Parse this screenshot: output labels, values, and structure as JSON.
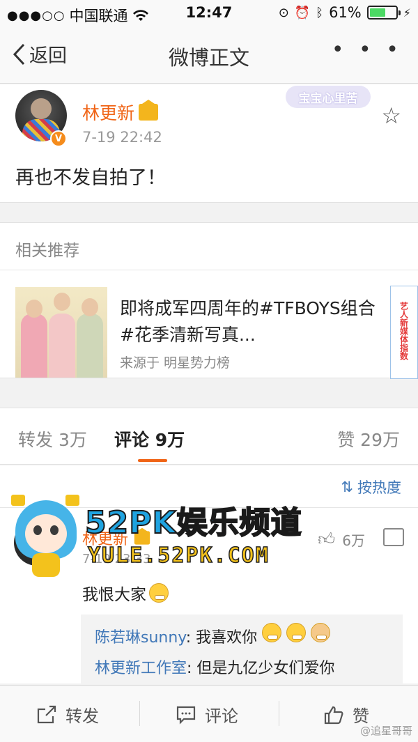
{
  "status_bar": {
    "carrier": "中国联通",
    "time": "12:47",
    "battery": "61%"
  },
  "navbar": {
    "back_label": "返回",
    "title": "微博正文",
    "more": "• • •"
  },
  "post": {
    "author": "林更新",
    "time": "7-19 22:42",
    "text": "再也不发自拍了！",
    "sticker_text": "宝宝心里苦",
    "verified": "V"
  },
  "recommend": {
    "heading": "相关推荐",
    "title": "即将成军四周年的#TFBOYS组合#花季清新写真...",
    "source": "来源于 明星势力榜",
    "side_text": "艺人新媒体指数"
  },
  "tabs": {
    "repost": "转发 3万",
    "comment": "评论 9万",
    "like": "赞 29万"
  },
  "comments": {
    "sort_label": "按热度",
    "author": "林更新",
    "time": "7-19 23:33",
    "likes": "6万",
    "text": "我恨大家",
    "replies": [
      {
        "name": "陈若琳sunny",
        "text": "我喜欢你"
      },
      {
        "name": "林更新工作室",
        "text": "但是九亿少女们爱你"
      }
    ]
  },
  "watermark": {
    "title": "52PK娱乐频道",
    "url": "YULE.52PK.COM"
  },
  "bottom_bar": {
    "repost": "转发",
    "comment": "评论",
    "like": "赞",
    "credit": "@追星哥哥"
  }
}
